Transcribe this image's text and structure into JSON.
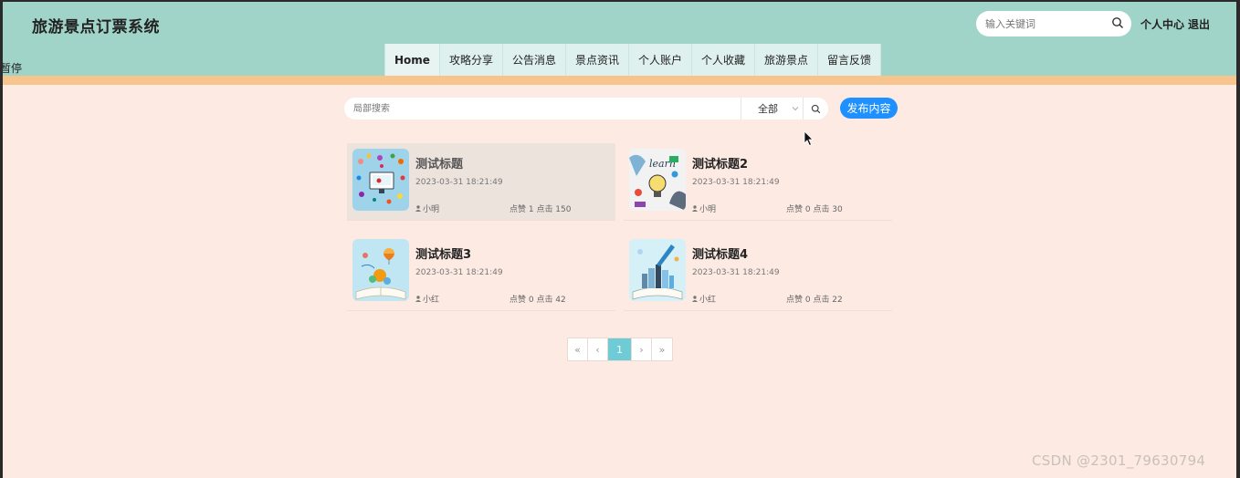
{
  "header": {
    "site_title": "旅游景点订票系统",
    "search_placeholder": "输入关键词",
    "user_center": "个人中心",
    "logout": "退出",
    "stray_text": "暂停"
  },
  "nav": {
    "items": [
      "Home",
      "攻略分享",
      "公告消息",
      "景点资讯",
      "个人账户",
      "个人收藏",
      "旅游景点",
      "留言反馈"
    ],
    "active_index": 0
  },
  "filter": {
    "search_placeholder": "局部搜索",
    "category_value": "全部",
    "publish_label": "发布内容"
  },
  "posts": [
    {
      "title": "测试标题",
      "date": "2023-03-31 18:21:49",
      "author": "小明",
      "stats": "点赞 1 点击 150",
      "thumb": "education-icons"
    },
    {
      "title": "测试标题2",
      "date": "2023-03-31 18:21:49",
      "author": "小明",
      "stats": "点赞 0 点击 30",
      "thumb": "learn-bulb"
    },
    {
      "title": "测试标题3",
      "date": "2023-03-31 18:21:49",
      "author": "小红",
      "stats": "点赞 0 点击 42",
      "thumb": "open-book-balloon"
    },
    {
      "title": "测试标题4",
      "date": "2023-03-31 18:21:49",
      "author": "小红",
      "stats": "点赞 0 点击 22",
      "thumb": "open-book-city"
    }
  ],
  "pagination": {
    "first": "«",
    "prev": "‹",
    "current": "1",
    "next": "›",
    "last": "»"
  },
  "watermark": "CSDN @2301_79630794",
  "colors": {
    "header_bg": "#a0d4c9",
    "accent_bar": "#f7c48d",
    "page_bg": "#fdeae3",
    "primary_button": "#1e90ff",
    "pager_active": "#6fcbd6"
  }
}
